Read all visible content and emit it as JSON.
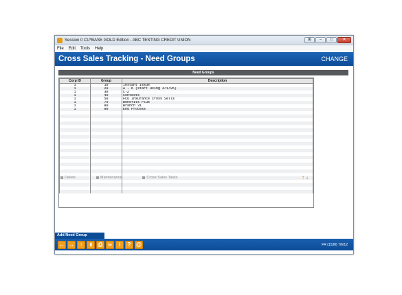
{
  "window": {
    "title": "Session 0 CU*BASE GOLD Edition - ABC TESTING CREDIT UNION",
    "controls": [
      "⊞",
      "–",
      "▭",
      "✕"
    ]
  },
  "menu": [
    "File",
    "Edit",
    "Tools",
    "Help"
  ],
  "header": {
    "title": "Cross Sales Tracking - Need Groups",
    "mode": "CHANGE"
  },
  "panel": {
    "title": "Need Groups"
  },
  "table": {
    "columns": [
      "Corp ID",
      "Group",
      "Description"
    ],
    "rows": [
      [
        "1",
        "10",
        "Instant Issue"
      ],
      [
        "1",
        "20",
        "A - K (start using 4/1/05)"
      ],
      [
        "1",
        "30",
        "L-Z"
      ],
      [
        "1",
        "40",
        "Contests"
      ],
      [
        "1",
        "50",
        "FCU Insurance Cross Sells"
      ],
      [
        "1",
        "70",
        "Benefits Plus"
      ],
      [
        "1",
        "80",
        "Branch 31"
      ],
      [
        "1",
        "90",
        "End Process"
      ]
    ]
  },
  "actions": [
    "Delete",
    "Maintenance",
    "Cross Sales Tasks"
  ],
  "add_button": "Add Need Group",
  "toolbar_icons": [
    "back-arrow-icon",
    "forward-arrow-icon",
    "up-arrow-icon",
    "pause-icon",
    "print-icon",
    "link-icon",
    "info-icon",
    "help-icon",
    "at-icon"
  ],
  "status": "FR (1538) 7/6/12"
}
